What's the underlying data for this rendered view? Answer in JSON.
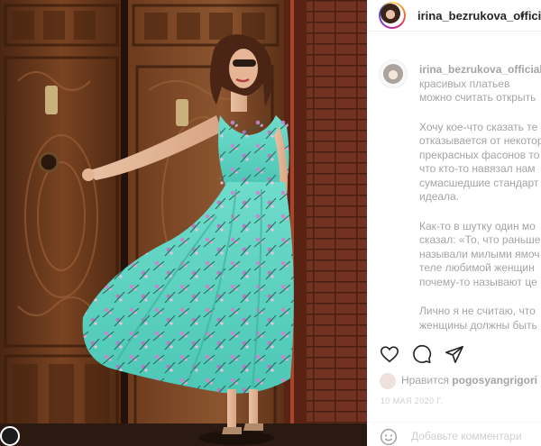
{
  "post": {
    "username": "irina_bezrukova_official",
    "header_separator": "•",
    "caption_lines": [
      "красивых платьев",
      "можно считать открыть"
    ],
    "paragraphs": [
      [
        "Хочу кое-что сказать те",
        "отказывается от некотор",
        "прекрасных фасонов то",
        "что кто-то навязал нам",
        "сумасшедшие стандарт",
        "идеала."
      ],
      [
        "Как-то в шутку один мо",
        "сказал: «То, что раньше",
        "называли милыми ямоч",
        "теле любимой женщин",
        "почему-то называют це"
      ],
      [
        "Лично я не считаю, что",
        "женщины должны быть"
      ]
    ],
    "liked_prefix": "Нравится",
    "liked_by": "pogosyangrigori",
    "date": "10 МАЯ 2020 Г.",
    "comment_placeholder": "Добавьте комментари"
  },
  "icons": {
    "like": "heart-icon",
    "comment": "comment-bubble-icon",
    "share": "paper-plane-icon",
    "emoji": "smiley-icon"
  },
  "colors": {
    "text": "#262626",
    "secondary": "#8e8e8e",
    "divider": "#efefef",
    "story_ring": "#d62976",
    "dress": "#5fd6c4"
  }
}
